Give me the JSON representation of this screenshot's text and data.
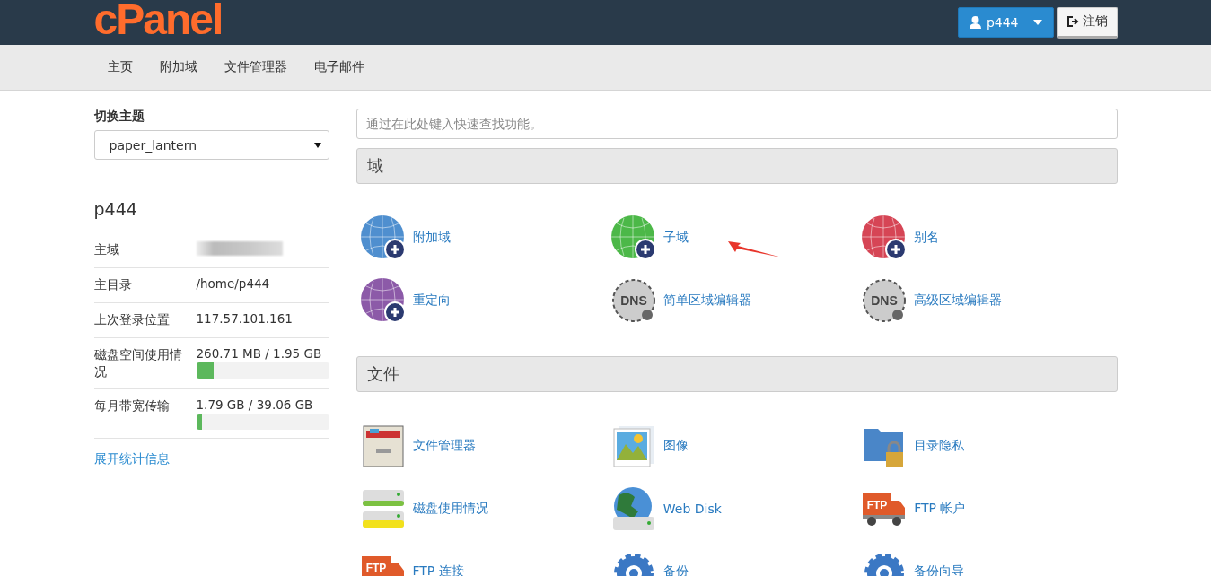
{
  "header": {
    "logo": "cPanel",
    "user_button": "p444",
    "logout_button": "注销"
  },
  "nav": [
    {
      "label": "主页"
    },
    {
      "label": "附加域"
    },
    {
      "label": "文件管理器"
    },
    {
      "label": "电子邮件"
    }
  ],
  "sidebar": {
    "theme_label": "切换主题",
    "theme_select": "paper_lantern",
    "username": "p444",
    "stats": [
      {
        "kind": "redacted",
        "label": "主域"
      },
      {
        "kind": "text",
        "label": "主目录",
        "value": "/home/p444"
      },
      {
        "kind": "text",
        "label": "上次登录位置",
        "value": "117.57.101.161"
      },
      {
        "kind": "meter",
        "label": "磁盘空间使用情况",
        "value": "260.71 MB / 1.95 GB",
        "level": 0.13
      },
      {
        "kind": "meter",
        "label": "每月带宽传输",
        "value": "1.79 GB / 39.06 GB",
        "level": 0.046
      }
    ],
    "expand_link": "展开统计信息"
  },
  "search": {
    "placeholder": "通过在此处键入快速查找功能。"
  },
  "sections": [
    {
      "title": "域",
      "items": [
        {
          "kind": "globe",
          "color": "#4f8fcf",
          "label": "附加域"
        },
        {
          "kind": "globe",
          "color": "#4cb848",
          "label": "子域"
        },
        {
          "kind": "globe",
          "color": "#d64555",
          "label": "别名"
        },
        {
          "kind": "globe",
          "color": "#8c5aa8",
          "label": "重定向"
        },
        {
          "kind": "dns",
          "icon_text": "DNS",
          "label": "简单区域编辑器"
        },
        {
          "kind": "dns",
          "icon_text": "DNS",
          "label": "高级区域编辑器"
        }
      ]
    },
    {
      "title": "文件",
      "items": [
        {
          "kind": "cabinet",
          "label": "文件管理器"
        },
        {
          "kind": "image",
          "label": "图像"
        },
        {
          "kind": "folder",
          "label": "目录隐私"
        },
        {
          "kind": "disk",
          "label": "磁盘使用情况"
        },
        {
          "kind": "webdisk",
          "label": "Web Disk"
        },
        {
          "kind": "truck",
          "icon_text": "FTP",
          "label": "FTP 帐户"
        },
        {
          "kind": "truck",
          "icon_text": "FTP",
          "label": "FTP 连接"
        },
        {
          "kind": "gear",
          "label": "备份"
        },
        {
          "kind": "gear",
          "label": "备份向导"
        }
      ]
    }
  ],
  "annotation": {
    "kind": "arrow"
  }
}
